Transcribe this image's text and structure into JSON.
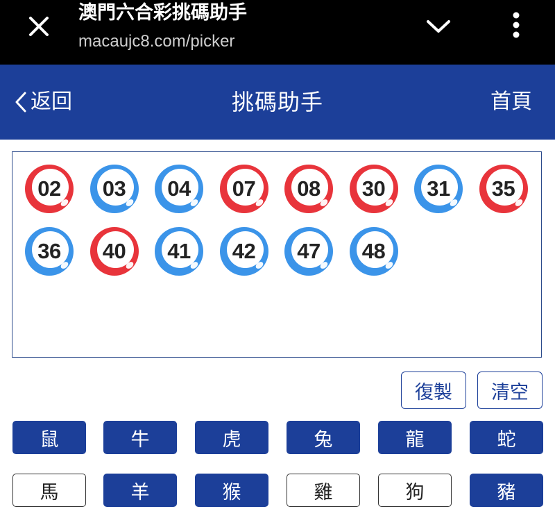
{
  "browser": {
    "title": "澳門六合彩挑碼助手",
    "url": "macaujc8.com/picker"
  },
  "header": {
    "back_label": "返回",
    "title": "挑碼助手",
    "home_label": "首頁",
    "color": "#1c3f99"
  },
  "colors": {
    "red_ball": "#e8343b",
    "blue_ball": "#3b94e9"
  },
  "selected_numbers": [
    {
      "num": "02",
      "color": "red"
    },
    {
      "num": "03",
      "color": "blue"
    },
    {
      "num": "04",
      "color": "blue"
    },
    {
      "num": "07",
      "color": "red"
    },
    {
      "num": "08",
      "color": "red"
    },
    {
      "num": "30",
      "color": "red"
    },
    {
      "num": "31",
      "color": "blue"
    },
    {
      "num": "35",
      "color": "red"
    },
    {
      "num": "36",
      "color": "blue"
    },
    {
      "num": "40",
      "color": "red"
    },
    {
      "num": "41",
      "color": "blue"
    },
    {
      "num": "42",
      "color": "blue"
    },
    {
      "num": "47",
      "color": "blue"
    },
    {
      "num": "48",
      "color": "blue"
    }
  ],
  "actions": {
    "copy_label": "復製",
    "clear_label": "清空"
  },
  "zodiacs": [
    {
      "label": "鼠",
      "selected": true
    },
    {
      "label": "牛",
      "selected": true
    },
    {
      "label": "虎",
      "selected": true
    },
    {
      "label": "兔",
      "selected": true
    },
    {
      "label": "龍",
      "selected": true
    },
    {
      "label": "蛇",
      "selected": true
    },
    {
      "label": "馬",
      "selected": false
    },
    {
      "label": "羊",
      "selected": true
    },
    {
      "label": "猴",
      "selected": true
    },
    {
      "label": "雞",
      "selected": false
    },
    {
      "label": "狗",
      "selected": false
    },
    {
      "label": "豬",
      "selected": true
    }
  ]
}
